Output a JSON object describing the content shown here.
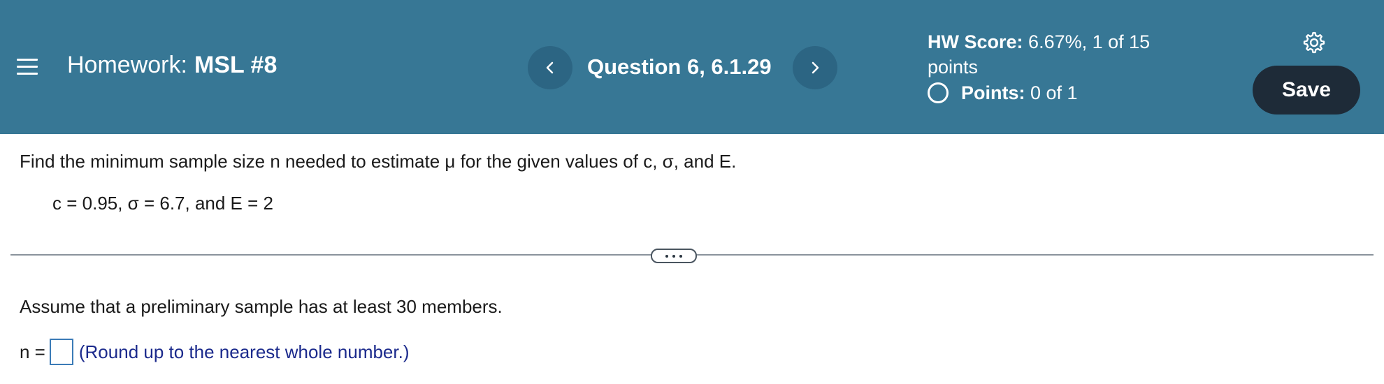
{
  "header": {
    "homework_prefix": "Homework:",
    "homework_name": "MSL #8",
    "question_title": "Question 6, 6.1.29",
    "hw_score_label": "HW Score:",
    "hw_score_value": "6.67%, 1 of 15 points",
    "points_label": "Points:",
    "points_value": "0 of 1",
    "save_label": "Save",
    "colors": {
      "header_bg": "#377795",
      "nav_button_bg": "#2c6583",
      "save_button_bg": "#1e2b38"
    },
    "icons": [
      "menu-icon",
      "chevron-left-icon",
      "chevron-right-icon",
      "gear-icon"
    ]
  },
  "question": {
    "prompt": "Find the minimum sample size n needed to estimate μ for the given values of c, σ, and E.",
    "given": "c = 0.95, σ = 6.7, and E = 2",
    "assumption": "Assume that a preliminary sample has at least 30 members.",
    "answer_label": "n =",
    "answer_value": "",
    "answer_hint": "(Round up to the nearest whole number.)"
  }
}
